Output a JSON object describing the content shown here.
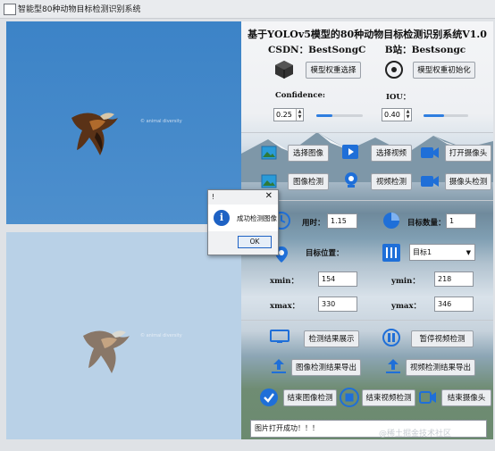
{
  "window": {
    "title": "智能型80种动物目标检测识别系统"
  },
  "left_panes": {
    "watermark_top": "© animal diversity",
    "watermark_bottom": "© animal diversity"
  },
  "header": {
    "title": "基于YOLOv5模型的80种动物目标检测识别系统V1.0",
    "csdn_label": "CSDN：",
    "csdn_value": "BestSongC",
    "bilibili_label": "B站：",
    "bilibili_value": "Bestsongc"
  },
  "model": {
    "select_weights": "模型权重选择",
    "init_weights": "模型权重初始化"
  },
  "thresholds": {
    "confidence_label": "Confidence:",
    "confidence_value": "0.25",
    "confidence_level": 0.35,
    "iou_label": "IOU：",
    "iou_value": "0.40",
    "iou_level": 0.45
  },
  "actions": {
    "select_image": "选择图像",
    "select_video": "选择视频",
    "open_camera": "打开摄像头",
    "image_detect": "图像检测",
    "video_detect": "视频检测",
    "camera_detect": "摄像头检测"
  },
  "results": {
    "time_label": "用时：",
    "time_value": "1.15",
    "count_label": "目标数量：",
    "count_value": "1",
    "position_label": "目标位置：",
    "target_select": "目标1",
    "xmin_label": "xmin：",
    "xmin_value": "154",
    "ymin_label": "ymin：",
    "ymin_value": "218",
    "xmax_label": "xmax：",
    "xmax_value": "330",
    "ymax_label": "ymax：",
    "ymax_value": "346"
  },
  "bottom_actions": {
    "show_results": "检测结果展示",
    "pause_video": "暂停视频检测",
    "export_image": "图像检测结果导出",
    "export_video": "视频检测结果导出",
    "end_image": "结束图像检测",
    "end_video": "结束视频检测",
    "end_camera": "结束摄像头"
  },
  "status": {
    "message": "图片打开成功！！！"
  },
  "footer": {
    "watermark": "@稀土掘金技术社区"
  },
  "dialog": {
    "title": "!",
    "message": "成功检测图像",
    "ok": "OK"
  },
  "colors": {
    "accent": "#2f7ee0",
    "info_icon": "#1e62c4",
    "sky": "#3c83c7"
  }
}
